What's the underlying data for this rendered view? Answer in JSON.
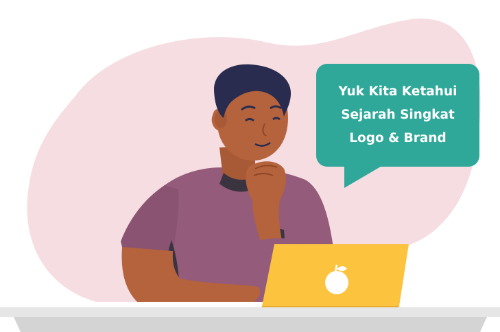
{
  "speech_bubble": {
    "lines": [
      "Yuk Kita Ketahui",
      "Sejarah Singkat",
      "Logo & Brand"
    ],
    "background_color": "#2fa899",
    "text_color": "#ffffff"
  },
  "illustration": {
    "subject": "man-thinking-at-laptop",
    "laptop_logo": "fruit-icon",
    "colors": {
      "blob": "#f6dde2",
      "skin": "#b5633c",
      "hair": "#2a2c4f",
      "shirt": "#945b7a",
      "laptop": "#fcc33f",
      "desk": "#e6e6e6"
    }
  }
}
